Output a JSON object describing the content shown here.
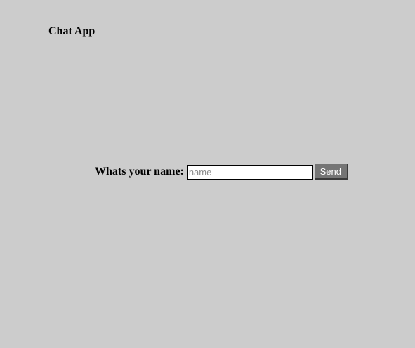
{
  "app": {
    "title": "Chat App"
  },
  "name_form": {
    "label": "Whats your name:",
    "input_value": "",
    "input_placeholder": "name",
    "send_label": "Send"
  },
  "colors": {
    "background": "#cccccc",
    "button_background": "#757575",
    "button_text": "#ffffff"
  }
}
